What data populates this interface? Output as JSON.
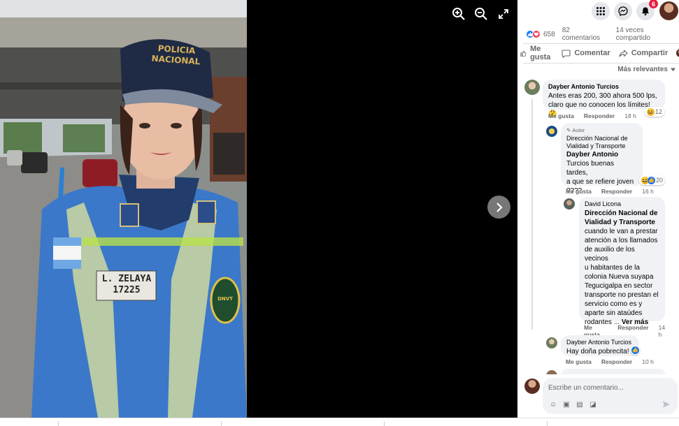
{
  "viewer": {
    "controls": [
      "zoom-in-icon",
      "zoom-out-icon",
      "fullscreen-icon"
    ],
    "photo": {
      "cap_text_line1": "POLICIA",
      "cap_text_line2": "NACIONAL",
      "name_tag_line1": "L. ZELAYA",
      "name_tag_line2": "17225",
      "badge_text": "DNVT"
    }
  },
  "topbar": {
    "notifications_count": "6"
  },
  "stats": {
    "reactions_count": "658",
    "comments": "82 comentarios",
    "shares": "14 veces compartido"
  },
  "actions": {
    "like": "Me gusta",
    "comment": "Comentar",
    "share": "Compartir"
  },
  "sort_label": "Más relevantes",
  "comments": [
    {
      "author": "Dayber Antonio Turcios",
      "text_line1": "Antes eras 200, 300 ahora 500 lps,",
      "text_line2": "claro que no conocen los límites! 🤔",
      "like": "Me gusta",
      "reply": "Responder",
      "time": "18 h",
      "reactions": "12"
    },
    {
      "author_tag": "Autor",
      "author_line1": "Dirección Nacional de",
      "author_line2": "Vialidad y Transporte",
      "mention_line1": "Dayber Antonio",
      "text_line1": "Turcios buenas tardes,",
      "text_line2": "a que se refiere joven",
      "text_line3": "????",
      "like": "Me gusta",
      "reply": "Responder",
      "time": "16 h",
      "reactions": "20"
    },
    {
      "author": "David Licona",
      "mention_line1": "Dirección Nacional de",
      "mention_line2": "Vialidad y Transporte",
      "lines": [
        "cuando le van a prestar",
        "atención a los llamados",
        "de auxilio de los vecinos",
        "u habitantes de la",
        "colonia Nueva suyapa",
        "Tegucigalpa en sector",
        "transporte no prestan el",
        "servicio como es y",
        "aparte sin ataúdes",
        "rodantes ..."
      ],
      "see_more": "Ver más",
      "like": "Me gusta",
      "reply": "Responder",
      "time": "14 h"
    },
    {
      "author": "Dayber Antonio Turcios",
      "text": "Hay doña pobrecita!",
      "like": "Me gusta",
      "reply": "Responder",
      "time": "10 h"
    }
  ],
  "composer": {
    "placeholder": "Escribe un comentario..."
  },
  "colors": {
    "like_blue": "#1877f2",
    "love_red": "#f33e58",
    "notif_red": "#e41e3f",
    "uniform_blue": "#2f6fc0"
  }
}
